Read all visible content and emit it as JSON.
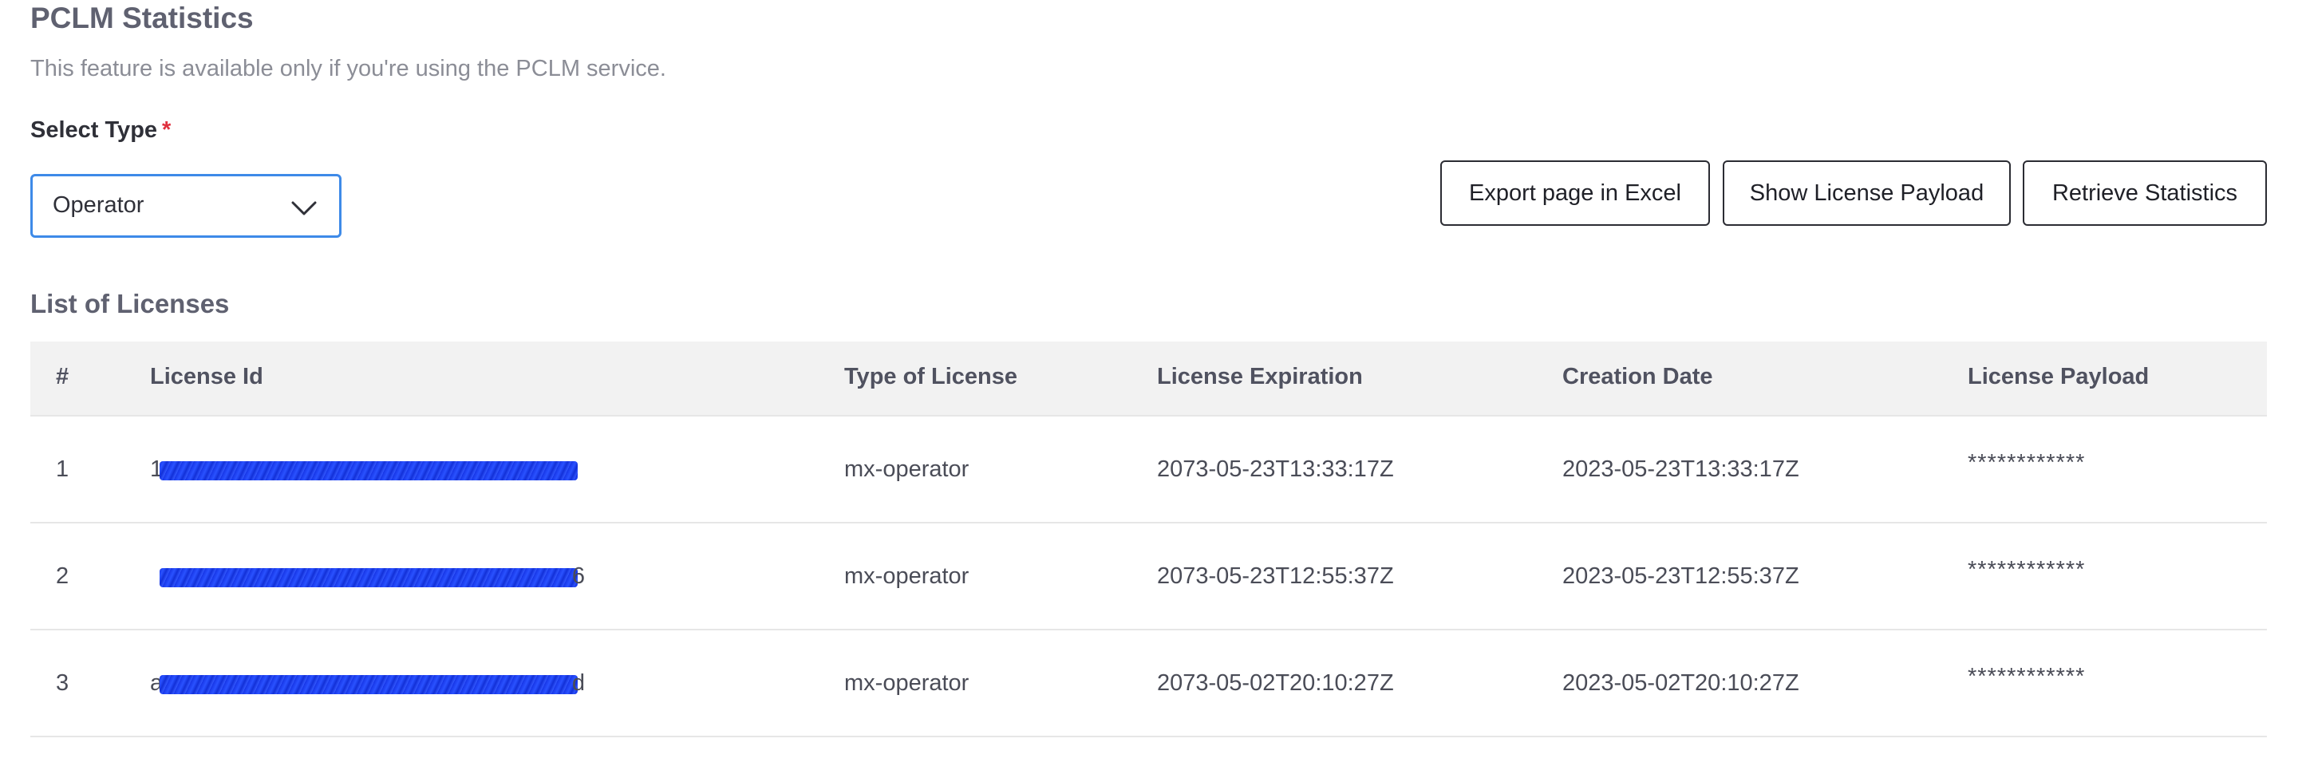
{
  "page": {
    "title": "PCLM Statistics",
    "subtitle": "This feature is available only if you're using the PCLM service."
  },
  "form": {
    "select_label": "Select Type",
    "required_mark": "*",
    "select_value": "Operator"
  },
  "actions": {
    "export_label": "Export page in Excel",
    "show_payload_label": "Show License Payload",
    "retrieve_label": "Retrieve Statistics"
  },
  "licenses": {
    "title": "List of Licenses",
    "columns": [
      "#",
      "License Id",
      "Type of License",
      "License Expiration",
      "Creation Date",
      "License Payload"
    ],
    "rows": [
      {
        "num": "1",
        "id_start": "1",
        "id_end": "",
        "type": "mx-operator",
        "expiration": "2073-05-23T13:33:17Z",
        "created": "2023-05-23T13:33:17Z",
        "payload": "************"
      },
      {
        "num": "2",
        "id_start": "",
        "id_end": "6",
        "type": "mx-operator",
        "expiration": "2073-05-23T12:55:37Z",
        "created": "2023-05-23T12:55:37Z",
        "payload": "************"
      },
      {
        "num": "3",
        "id_start": "a",
        "id_end": "d",
        "type": "mx-operator",
        "expiration": "2073-05-02T20:10:27Z",
        "created": "2023-05-02T20:10:27Z",
        "payload": "************"
      }
    ]
  },
  "icons": {
    "select_chevron": "chevron-down-icon"
  },
  "colors": {
    "focus_border": "#3e8ae8",
    "required": "#e0303e",
    "redaction": "#1736e6",
    "header_bg": "#f2f2f2"
  }
}
